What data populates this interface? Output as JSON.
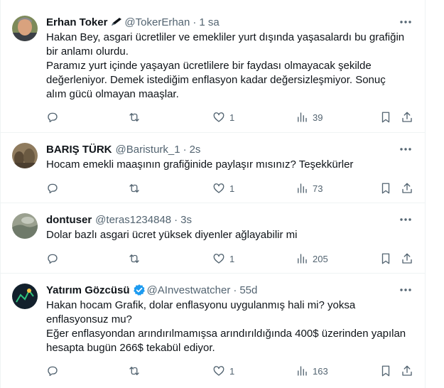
{
  "tweets": [
    {
      "name": "Erhan Toker",
      "handle": "@TokerErhan",
      "separator": "·",
      "time": "1 sa",
      "lines": [
        "Hakan Bey, asgari ücretliler ve emekliler yurt dışında yaşasalardı bu grafiğin",
        "bir anlamı olurdu.",
        "Paramız yurt içinde yaşayan ücretlilere bir faydası olmayacak şekilde",
        "değerleniyor. Demek istediğim enflasyon kadar değersizleşmiyor. Sonuç",
        "alım gücü olmayan maaşlar."
      ],
      "likes": "1",
      "views": "39",
      "icons": {
        "badge": "pen-icon",
        "avatar": "avatar-photo"
      }
    },
    {
      "name": "BARIŞ TÜRK",
      "handle": "@Baristurk_1",
      "separator": "·",
      "time": "2s",
      "lines": [
        "Hocam emekli maaşının grafiğinide paylaşır mısınız? Teşekkürler"
      ],
      "likes": "1",
      "views": "73"
    },
    {
      "name": "dontuser",
      "handle": "@teras1234848",
      "separator": "·",
      "time": "3s",
      "lines": [
        "Dolar bazlı asgari ücret yüksek diyenler ağlayabilir mi"
      ],
      "likes": "1",
      "views": "205"
    },
    {
      "name": "Yatırım Gözcüsü",
      "handle": "@AInvestwatcher",
      "separator": "·",
      "time": "55d",
      "lines": [
        "Hakan hocam Grafik, dolar enflasyonu uygulanmış hali mi? yoksa",
        "enflasyonsuz mu?",
        "Eğer enflasyondan arındırılmamışsa arındırıldığında 400$ üzerinden yapılan",
        "hesapta bugün 266$ tekabül ediyor."
      ],
      "likes": "1",
      "views": "163",
      "icons": {
        "badge": "verified-badge-icon"
      }
    }
  ],
  "colors": {
    "text": "#0f1419",
    "muted": "#536471",
    "divider": "#eff3f4",
    "verified": "#1d9bf0"
  }
}
